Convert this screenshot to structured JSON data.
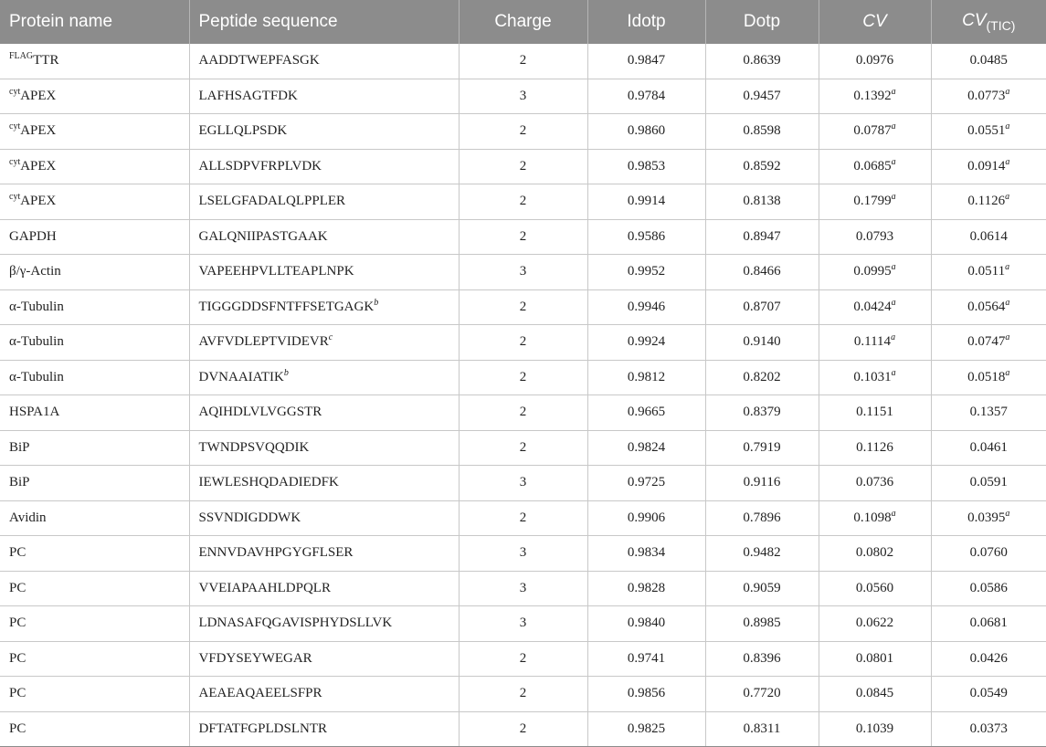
{
  "headers": {
    "protein": "Protein name",
    "peptide": "Peptide sequence",
    "charge": "Charge",
    "idotp": "Idotp",
    "dotp": "Dotp",
    "cv": "CV",
    "cvtic_main": "CV",
    "cvtic_sub": "(TIC)"
  },
  "rows": [
    {
      "pre": "FLAG",
      "protein": "TTR",
      "peptide": "AADDTWEPFASGK",
      "pep_mark": "",
      "charge": "2",
      "idotp": "0.9847",
      "dotp": "0.8639",
      "cv": "0.0976",
      "cv_mark": "",
      "cvtic": "0.0485",
      "cvtic_mark": ""
    },
    {
      "pre": "cyt",
      "protein": "APEX",
      "peptide": "LAFHSAGTFDK",
      "pep_mark": "",
      "charge": "3",
      "idotp": "0.9784",
      "dotp": "0.9457",
      "cv": "0.1392",
      "cv_mark": "a",
      "cvtic": "0.0773",
      "cvtic_mark": "a"
    },
    {
      "pre": "cyt",
      "protein": "APEX",
      "peptide": "EGLLQLPSDK",
      "pep_mark": "",
      "charge": "2",
      "idotp": "0.9860",
      "dotp": "0.8598",
      "cv": "0.0787",
      "cv_mark": "a",
      "cvtic": "0.0551",
      "cvtic_mark": "a"
    },
    {
      "pre": "cyt",
      "protein": "APEX",
      "peptide": "ALLSDPVFRPLVDK",
      "pep_mark": "",
      "charge": "2",
      "idotp": "0.9853",
      "dotp": "0.8592",
      "cv": "0.0685",
      "cv_mark": "a",
      "cvtic": "0.0914",
      "cvtic_mark": "a"
    },
    {
      "pre": "cyt",
      "protein": "APEX",
      "peptide": "LSELGFADALQLPPLER",
      "pep_mark": "",
      "charge": "2",
      "idotp": "0.9914",
      "dotp": "0.8138",
      "cv": "0.1799",
      "cv_mark": "a",
      "cvtic": "0.1126",
      "cvtic_mark": "a"
    },
    {
      "pre": "",
      "protein": "GAPDH",
      "peptide": "GALQNIIPASTGAAK",
      "pep_mark": "",
      "charge": "2",
      "idotp": "0.9586",
      "dotp": "0.8947",
      "cv": "0.0793",
      "cv_mark": "",
      "cvtic": "0.0614",
      "cvtic_mark": ""
    },
    {
      "pre": "",
      "protein": "β/γ-Actin",
      "peptide": "VAPEEHPVLLTEAPLNPK",
      "pep_mark": "",
      "charge": "3",
      "idotp": "0.9952",
      "dotp": "0.8466",
      "cv": "0.0995",
      "cv_mark": "a",
      "cvtic": "0.0511",
      "cvtic_mark": "a"
    },
    {
      "pre": "",
      "protein": "α-Tubulin",
      "peptide": "TIGGGDDSFNTFFSETGAGK",
      "pep_mark": "b",
      "charge": "2",
      "idotp": "0.9946",
      "dotp": "0.8707",
      "cv": "0.0424",
      "cv_mark": "a",
      "cvtic": "0.0564",
      "cvtic_mark": "a"
    },
    {
      "pre": "",
      "protein": "α-Tubulin",
      "peptide": "AVFVDLEPTVIDEVR",
      "pep_mark": "c",
      "charge": "2",
      "idotp": "0.9924",
      "dotp": "0.9140",
      "cv": "0.1114",
      "cv_mark": "a",
      "cvtic": "0.0747",
      "cvtic_mark": "a"
    },
    {
      "pre": "",
      "protein": "α-Tubulin",
      "peptide": "DVNAAIATIK",
      "pep_mark": "b",
      "charge": "2",
      "idotp": "0.9812",
      "dotp": "0.8202",
      "cv": "0.1031",
      "cv_mark": "a",
      "cvtic": "0.0518",
      "cvtic_mark": "a"
    },
    {
      "pre": "",
      "protein": "HSPA1A",
      "peptide": "AQIHDLVLVGGSTR",
      "pep_mark": "",
      "charge": "2",
      "idotp": "0.9665",
      "dotp": "0.8379",
      "cv": "0.1151",
      "cv_mark": "",
      "cvtic": "0.1357",
      "cvtic_mark": ""
    },
    {
      "pre": "",
      "protein": "BiP",
      "peptide": "TWNDPSVQQDIK",
      "pep_mark": "",
      "charge": "2",
      "idotp": "0.9824",
      "dotp": "0.7919",
      "cv": "0.1126",
      "cv_mark": "",
      "cvtic": "0.0461",
      "cvtic_mark": ""
    },
    {
      "pre": "",
      "protein": "BiP",
      "peptide": "IEWLESHQDADIEDFK",
      "pep_mark": "",
      "charge": "3",
      "idotp": "0.9725",
      "dotp": "0.9116",
      "cv": "0.0736",
      "cv_mark": "",
      "cvtic": "0.0591",
      "cvtic_mark": ""
    },
    {
      "pre": "",
      "protein": "Avidin",
      "peptide": "SSVNDIGDDWK",
      "pep_mark": "",
      "charge": "2",
      "idotp": "0.9906",
      "dotp": "0.7896",
      "cv": "0.1098",
      "cv_mark": "a",
      "cvtic": "0.0395",
      "cvtic_mark": "a"
    },
    {
      "pre": "",
      "protein": "PC",
      "peptide": "ENNVDAVHPGYGFLSER",
      "pep_mark": "",
      "charge": "3",
      "idotp": "0.9834",
      "dotp": "0.9482",
      "cv": "0.0802",
      "cv_mark": "",
      "cvtic": "0.0760",
      "cvtic_mark": ""
    },
    {
      "pre": "",
      "protein": "PC",
      "peptide": "VVEIAPAAHLDPQLR",
      "pep_mark": "",
      "charge": "3",
      "idotp": "0.9828",
      "dotp": "0.9059",
      "cv": "0.0560",
      "cv_mark": "",
      "cvtic": "0.0586",
      "cvtic_mark": ""
    },
    {
      "pre": "",
      "protein": "PC",
      "peptide": "LDNASAFQGAVISPHYDSLLVK",
      "pep_mark": "",
      "charge": "3",
      "idotp": "0.9840",
      "dotp": "0.8985",
      "cv": "0.0622",
      "cv_mark": "",
      "cvtic": "0.0681",
      "cvtic_mark": ""
    },
    {
      "pre": "",
      "protein": "PC",
      "peptide": "VFDYSEYWEGAR",
      "pep_mark": "",
      "charge": "2",
      "idotp": "0.9741",
      "dotp": "0.8396",
      "cv": "0.0801",
      "cv_mark": "",
      "cvtic": "0.0426",
      "cvtic_mark": ""
    },
    {
      "pre": "",
      "protein": "PC",
      "peptide": "AEAEAQAEELSFPR",
      "pep_mark": "",
      "charge": "2",
      "idotp": "0.9856",
      "dotp": "0.7720",
      "cv": "0.0845",
      "cv_mark": "",
      "cvtic": "0.0549",
      "cvtic_mark": ""
    },
    {
      "pre": "",
      "protein": "PC",
      "peptide": "DFTATFGPLDSLNTR",
      "pep_mark": "",
      "charge": "2",
      "idotp": "0.9825",
      "dotp": "0.8311",
      "cv": "0.1039",
      "cv_mark": "",
      "cvtic": "0.0373",
      "cvtic_mark": ""
    }
  ]
}
